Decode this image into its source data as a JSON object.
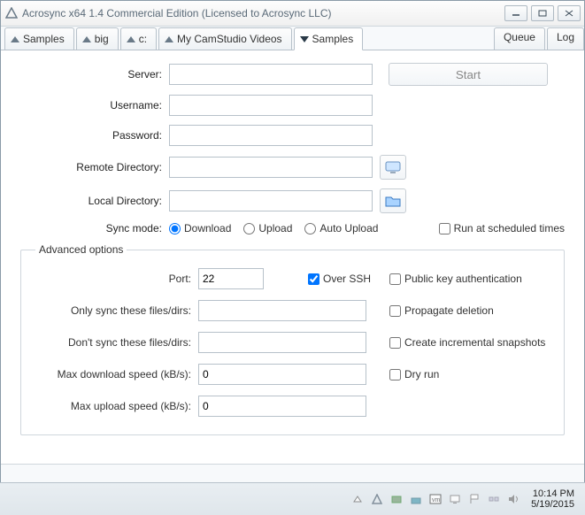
{
  "titlebar": {
    "title": "Acrosync x64 1.4 Commercial Edition (Licensed to Acrosync LLC)"
  },
  "tabs": {
    "items": [
      "Samples",
      "big",
      "c:",
      "My CamStudio Videos",
      "Samples"
    ],
    "queue": "Queue",
    "log": "Log"
  },
  "form": {
    "server_label": "Server:",
    "server_value": "",
    "start_label": "Start",
    "username_label": "Username:",
    "username_value": "",
    "password_label": "Password:",
    "password_value": "",
    "remote_dir_label": "Remote Directory:",
    "remote_dir_value": "",
    "local_dir_label": "Local Directory:",
    "local_dir_value": "",
    "sync_mode_label": "Sync mode:",
    "mode_download": "Download",
    "mode_upload": "Upload",
    "mode_auto": "Auto Upload",
    "run_scheduled": "Run at scheduled times"
  },
  "adv": {
    "legend": "Advanced options",
    "port_label": "Port:",
    "port_value": "22",
    "over_ssh": "Over SSH",
    "pubkey": "Public key authentication",
    "only_sync_label": "Only sync these files/dirs:",
    "only_sync_value": "",
    "propagate": "Propagate deletion",
    "dont_sync_label": "Don't sync these files/dirs:",
    "dont_sync_value": "",
    "snapshots": "Create incremental snapshots",
    "max_dl_label": "Max download speed (kB/s):",
    "max_dl_value": "0",
    "dry_run": "Dry run",
    "max_ul_label": "Max upload speed (kB/s):",
    "max_ul_value": "0"
  },
  "tray": {
    "time": "10:14 PM",
    "date": "5/19/2015"
  }
}
